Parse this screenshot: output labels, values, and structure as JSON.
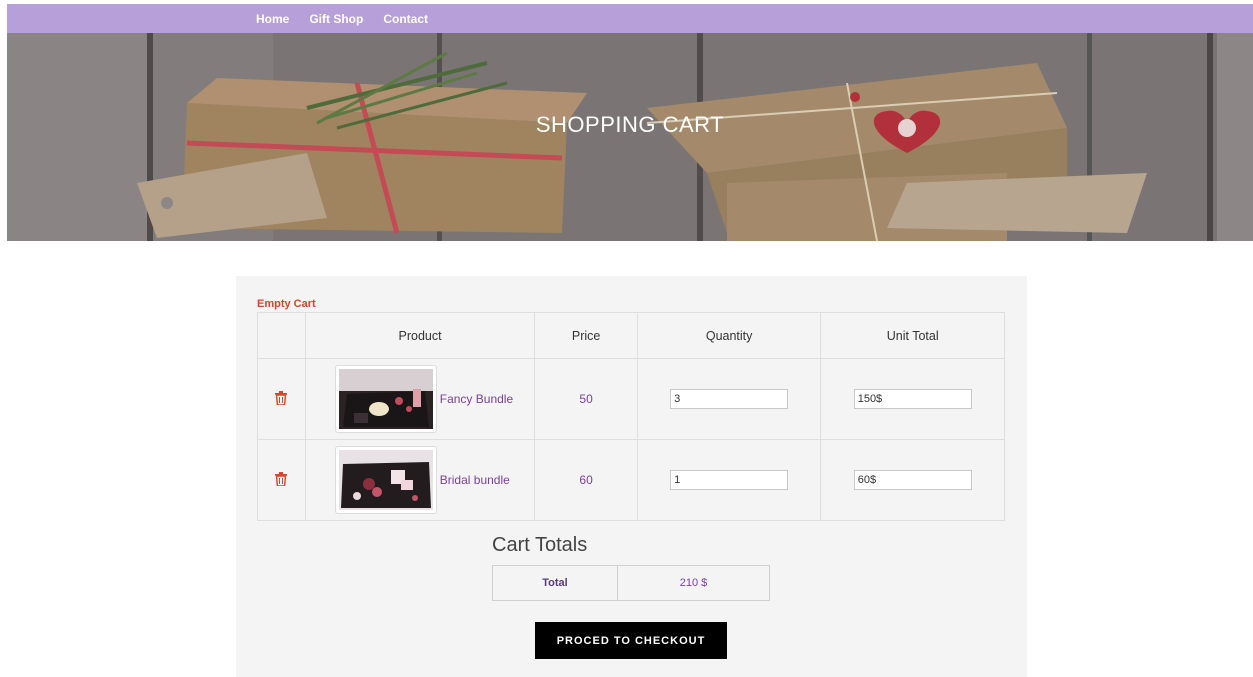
{
  "nav": {
    "items": [
      {
        "label": "Home"
      },
      {
        "label": "Gift Shop"
      },
      {
        "label": "Contact"
      }
    ]
  },
  "hero": {
    "title": "SHOPPING CART"
  },
  "cart": {
    "empty_label": "Empty Cart",
    "columns": [
      "",
      "Product",
      "Price",
      "Quantity",
      "Unit Total"
    ],
    "rows": [
      {
        "name": "Fancy Bundle",
        "price": "50",
        "quantity": "3",
        "unit_total": "150$"
      },
      {
        "name": "Bridal bundle",
        "price": "60",
        "quantity": "1",
        "unit_total": "60$"
      }
    ]
  },
  "totals": {
    "title": "Cart Totals",
    "label": "Total",
    "value": "210  $"
  },
  "checkout": {
    "label": "PROCED TO CHECKOUT"
  },
  "colors": {
    "nav": "#b79fd9",
    "accent": "#7a3fa2",
    "danger": "#d9442b",
    "button": "#000000"
  }
}
